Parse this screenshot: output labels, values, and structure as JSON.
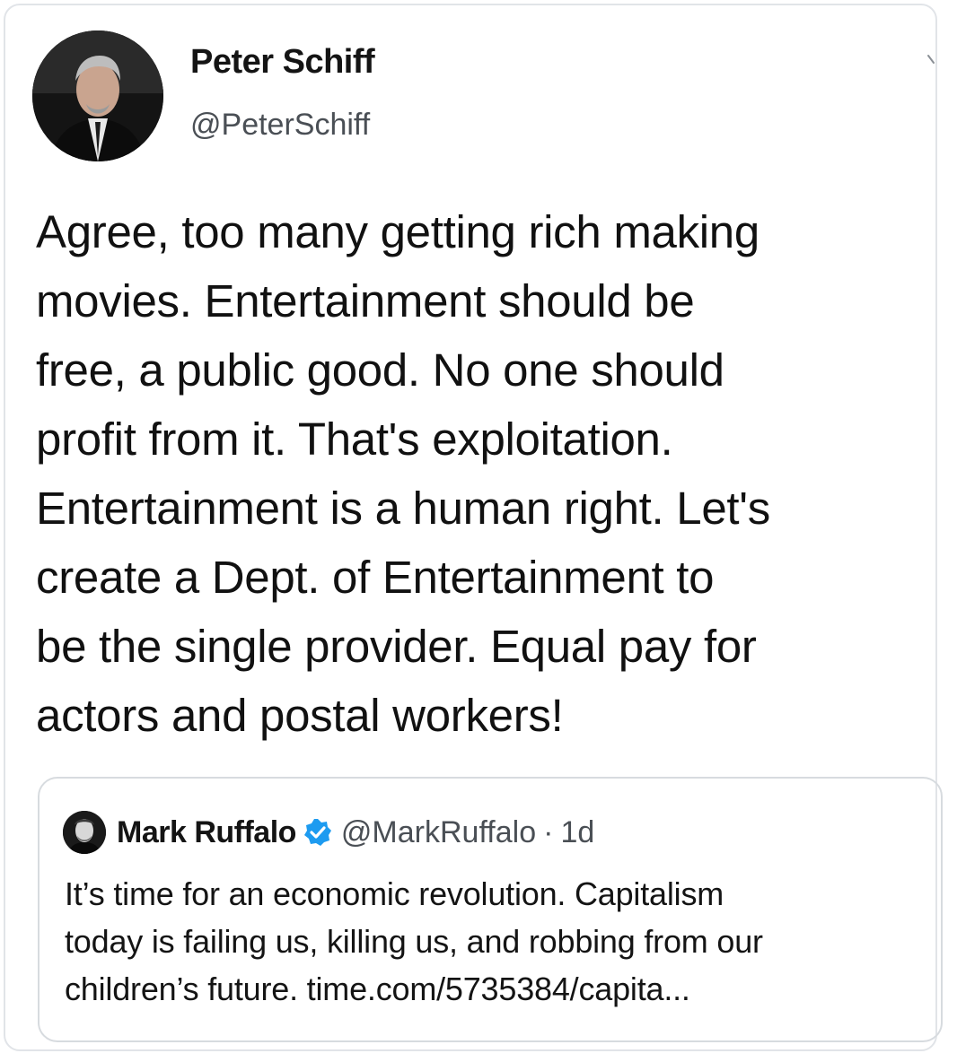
{
  "tweet": {
    "author_name": "Peter Schiff",
    "author_handle": "@PeterSchiff",
    "avatar_icon": "profile-photo",
    "menu_icon": "chevron-down-icon",
    "text": "Agree, too many getting rich making\nmovies. Entertainment should be\nfree, a public good. No one should\nprofit from it. That's exploitation.\nEntertainment is a human right. Let's\ncreate a Dept. of Entertainment to\nbe the single provider. Equal pay for\nactors and postal workers!"
  },
  "quoted_tweet": {
    "author_name": "Mark Ruffalo",
    "verified_icon": "verified-badge-icon",
    "verified_color": "#1d9bf0",
    "author_handle": "@MarkRuffalo",
    "separator": "·",
    "time": "1d",
    "text": "It’s time for an economic revolution. Capitalism\ntoday is failing us, killing us, and robbing from our\nchildren’s future. time.com/5735384/capita..."
  },
  "colors": {
    "text": "#111111",
    "secondary_text": "#4a4f55",
    "border": "#d7dbdf"
  }
}
